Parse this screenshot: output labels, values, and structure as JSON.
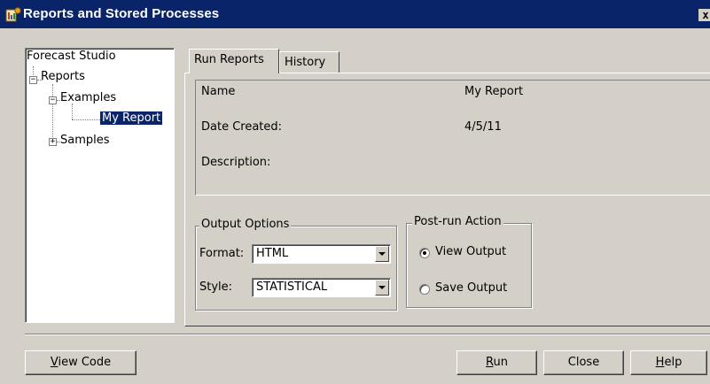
{
  "window": {
    "title": "Reports and Stored Processes",
    "close_glyph": "x"
  },
  "tree": {
    "root": "Forecast Studio",
    "reports": "Reports",
    "examples": "Examples",
    "my_report": "My Report",
    "samples": "Samples",
    "expanded_glyph": "−",
    "collapsed_glyph": "+"
  },
  "tabs": [
    {
      "label": "Run Reports"
    },
    {
      "label": "History"
    }
  ],
  "details": {
    "name_label": "Name",
    "name_value": "My Report",
    "date_label": "Date Created:",
    "date_value": "4/5/11",
    "description_label": "Description:"
  },
  "output_options": {
    "legend": "Output Options",
    "format_label": "Format:",
    "format_value": "HTML",
    "style_label": "Style:",
    "style_value": "STATISTICAL"
  },
  "post_run": {
    "legend": "Post-run Action",
    "view_output": "View Output",
    "save_output": "Save Output",
    "selected": "View Output"
  },
  "buttons": {
    "view_code": {
      "mnemonic": "V",
      "rest": "iew Code"
    },
    "run": {
      "mnemonic": "R",
      "rest": "un"
    },
    "close": "Close",
    "help": {
      "mnemonic": "H",
      "rest": "elp"
    }
  },
  "colors": {
    "titlebar": "#0a246a",
    "selection": "#0a246a",
    "face": "#d4d0c8"
  }
}
